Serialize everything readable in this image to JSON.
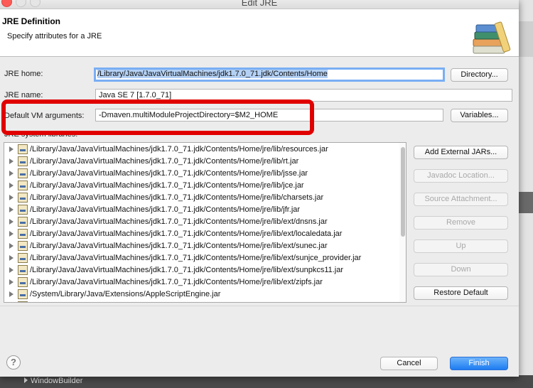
{
  "window": {
    "title": "Edit JRE"
  },
  "header": {
    "title": "JRE Definition",
    "subtitle": "Specify attributes for a JRE",
    "icon": "books-icon"
  },
  "form": {
    "jre_home_label": "JRE home:",
    "jre_home_value": "/Library/Java/JavaVirtualMachines/jdk1.7.0_71.jdk/Contents/Home",
    "directory_button": "Directory...",
    "jre_name_label": "JRE name:",
    "jre_name_value": "Java SE 7 [1.7.0_71]",
    "vm_args_label": "Default VM arguments:",
    "vm_args_value": "-Dmaven.multiModuleProjectDirectory=$M2_HOME",
    "variables_button": "Variables...",
    "libraries_label": "JRE system libraries:"
  },
  "libraries": [
    "/Library/Java/JavaVirtualMachines/jdk1.7.0_71.jdk/Contents/Home/jre/lib/resources.jar",
    "/Library/Java/JavaVirtualMachines/jdk1.7.0_71.jdk/Contents/Home/jre/lib/rt.jar",
    "/Library/Java/JavaVirtualMachines/jdk1.7.0_71.jdk/Contents/Home/jre/lib/jsse.jar",
    "/Library/Java/JavaVirtualMachines/jdk1.7.0_71.jdk/Contents/Home/jre/lib/jce.jar",
    "/Library/Java/JavaVirtualMachines/jdk1.7.0_71.jdk/Contents/Home/jre/lib/charsets.jar",
    "/Library/Java/JavaVirtualMachines/jdk1.7.0_71.jdk/Contents/Home/jre/lib/jfr.jar",
    "/Library/Java/JavaVirtualMachines/jdk1.7.0_71.jdk/Contents/Home/jre/lib/ext/dnsns.jar",
    "/Library/Java/JavaVirtualMachines/jdk1.7.0_71.jdk/Contents/Home/jre/lib/ext/localedata.jar",
    "/Library/Java/JavaVirtualMachines/jdk1.7.0_71.jdk/Contents/Home/jre/lib/ext/sunec.jar",
    "/Library/Java/JavaVirtualMachines/jdk1.7.0_71.jdk/Contents/Home/jre/lib/ext/sunjce_provider.jar",
    "/Library/Java/JavaVirtualMachines/jdk1.7.0_71.jdk/Contents/Home/jre/lib/ext/sunpkcs11.jar",
    "/Library/Java/JavaVirtualMachines/jdk1.7.0_71.jdk/Contents/Home/jre/lib/ext/zipfs.jar",
    "/System/Library/Java/Extensions/AppleScriptEngine.jar",
    ""
  ],
  "side_buttons": {
    "add_external_jars": "Add External JARs...",
    "javadoc_location": "Javadoc Location...",
    "source_attachment": "Source Attachment...",
    "remove": "Remove",
    "up": "Up",
    "down": "Down",
    "restore_default": "Restore Default"
  },
  "footer": {
    "help": "?",
    "cancel": "Cancel",
    "finish": "Finish"
  },
  "background": {
    "window_builder": "WindowBuilder"
  },
  "colors": {
    "annotation": "#e10000",
    "primary_button": "#1d7cf2",
    "focus_ring": "#79aef4"
  }
}
